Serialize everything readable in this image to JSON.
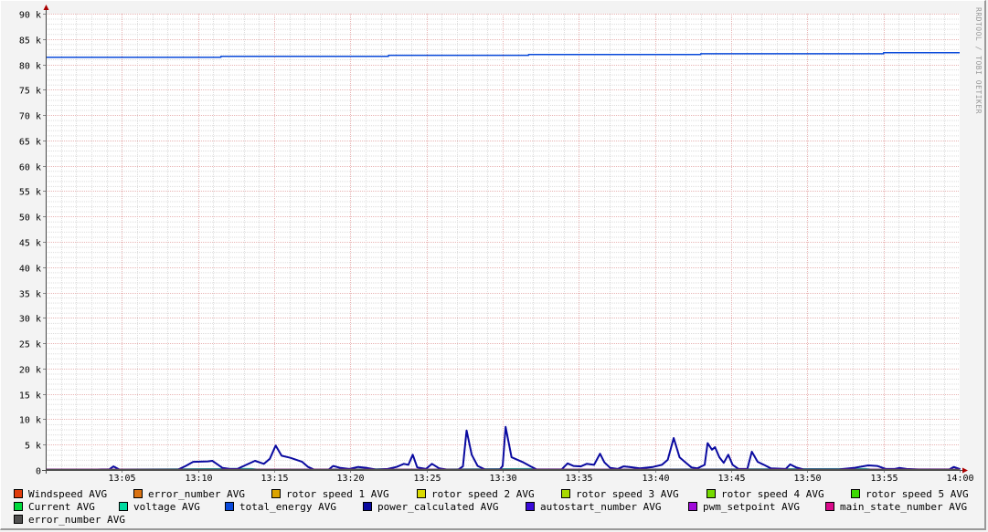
{
  "watermark": "RRDTOOL / TOBI OETIKER",
  "chart_data": {
    "type": "line",
    "title": "",
    "xlabel": "",
    "ylabel": "",
    "xlim_minutes": [
      0,
      60
    ],
    "ylim": [
      0,
      90000
    ],
    "grid": true,
    "legend_position": "bottom",
    "yticks": [
      {
        "value": 0,
        "label": "0"
      },
      {
        "value": 5000,
        "label": "5 k"
      },
      {
        "value": 10000,
        "label": "10 k"
      },
      {
        "value": 15000,
        "label": "15 k"
      },
      {
        "value": 20000,
        "label": "20 k"
      },
      {
        "value": 25000,
        "label": "25 k"
      },
      {
        "value": 30000,
        "label": "30 k"
      },
      {
        "value": 35000,
        "label": "35 k"
      },
      {
        "value": 40000,
        "label": "40 k"
      },
      {
        "value": 45000,
        "label": "45 k"
      },
      {
        "value": 50000,
        "label": "50 k"
      },
      {
        "value": 55000,
        "label": "55 k"
      },
      {
        "value": 60000,
        "label": "60 k"
      },
      {
        "value": 65000,
        "label": "65 k"
      },
      {
        "value": 70000,
        "label": "70 k"
      },
      {
        "value": 75000,
        "label": "75 k"
      },
      {
        "value": 80000,
        "label": "80 k"
      },
      {
        "value": 85000,
        "label": "85 k"
      },
      {
        "value": 90000,
        "label": "90 k"
      }
    ],
    "xticks": [
      {
        "minute": 5,
        "label": "13:05"
      },
      {
        "minute": 10,
        "label": "13:10"
      },
      {
        "minute": 15,
        "label": "13:15"
      },
      {
        "minute": 20,
        "label": "13:20"
      },
      {
        "minute": 25,
        "label": "13:25"
      },
      {
        "minute": 30,
        "label": "13:30"
      },
      {
        "minute": 35,
        "label": "13:35"
      },
      {
        "minute": 40,
        "label": "13:40"
      },
      {
        "minute": 45,
        "label": "13:45"
      },
      {
        "minute": 50,
        "label": "13:50"
      },
      {
        "minute": 55,
        "label": "13:55"
      },
      {
        "minute": 60,
        "label": "14:00"
      }
    ],
    "series": [
      {
        "name": "Windspeed AVG",
        "color": "#E03C0B",
        "points": [
          [
            0,
            0
          ],
          [
            60,
            0
          ]
        ]
      },
      {
        "name": "error_number AVG",
        "color": "#DA7211",
        "points": [
          [
            0,
            0
          ],
          [
            60,
            0
          ]
        ]
      },
      {
        "name": "rotor speed 1 AVG",
        "color": "#DAA300",
        "points": [
          [
            0,
            0
          ],
          [
            60,
            0
          ]
        ]
      },
      {
        "name": "rotor speed 2 AVG",
        "color": "#DADA00",
        "points": [
          [
            0,
            0
          ],
          [
            60,
            0
          ]
        ]
      },
      {
        "name": "rotor speed 3 AVG",
        "color": "#A8DA00",
        "points": [
          [
            0,
            0
          ],
          [
            60,
            0
          ]
        ]
      },
      {
        "name": "rotor speed 4 AVG",
        "color": "#75DA00",
        "points": [
          [
            0,
            0
          ],
          [
            60,
            0
          ]
        ]
      },
      {
        "name": "rotor speed 5 AVG",
        "color": "#3CDA00",
        "points": [
          [
            0,
            0
          ],
          [
            60,
            0
          ]
        ]
      },
      {
        "name": "Current AVG",
        "color": "#00DA3C",
        "points": [
          [
            0,
            0
          ],
          [
            60,
            0
          ]
        ]
      },
      {
        "name": "voltage AVG",
        "color": "#00DAA0",
        "points": [
          [
            0,
            80
          ],
          [
            13.5,
            250
          ],
          [
            14,
            80
          ],
          [
            22.3,
            200
          ],
          [
            23,
            80
          ],
          [
            31.8,
            250
          ],
          [
            32.3,
            80
          ],
          [
            53.8,
            250
          ],
          [
            54.3,
            80
          ],
          [
            60,
            80
          ]
        ]
      },
      {
        "name": "total_energy AVG",
        "color": "#0A4ADA",
        "points": [
          [
            0,
            81400
          ],
          [
            11.5,
            81400
          ],
          [
            11.5,
            81600
          ],
          [
            22.5,
            81600
          ],
          [
            22.5,
            81800
          ],
          [
            31.7,
            81800
          ],
          [
            31.7,
            81950
          ],
          [
            43,
            81950
          ],
          [
            43,
            82100
          ],
          [
            55,
            82100
          ],
          [
            55,
            82300
          ],
          [
            60,
            82300
          ]
        ]
      },
      {
        "name": "power_calculated AVG",
        "color": "#0A0AA0",
        "points": [
          [
            0,
            0
          ],
          [
            3.5,
            0
          ],
          [
            3.8,
            100
          ],
          [
            4.3,
            100
          ],
          [
            4.6,
            700
          ],
          [
            5,
            0
          ],
          [
            8,
            0
          ],
          [
            9,
            100
          ],
          [
            9.5,
            800
          ],
          [
            10,
            1600
          ],
          [
            11,
            1700
          ],
          [
            11.3,
            1800
          ],
          [
            11.6,
            1200
          ],
          [
            12,
            400
          ],
          [
            12.5,
            200
          ],
          [
            13,
            200
          ],
          [
            13.6,
            1000
          ],
          [
            14.2,
            1800
          ],
          [
            14.8,
            1200
          ],
          [
            15.2,
            2200
          ],
          [
            15.6,
            4800
          ],
          [
            16,
            2800
          ],
          [
            16.6,
            2400
          ],
          [
            17.4,
            1600
          ],
          [
            17.8,
            600
          ],
          [
            18.2,
            0
          ],
          [
            19.2,
            0
          ],
          [
            19.5,
            800
          ],
          [
            20,
            400
          ],
          [
            20.6,
            200
          ],
          [
            21.2,
            600
          ],
          [
            21.8,
            400
          ],
          [
            22.4,
            0
          ],
          [
            23.2,
            200
          ],
          [
            23.8,
            600
          ],
          [
            24.3,
            1200
          ],
          [
            24.6,
            1000
          ],
          [
            24.9,
            3000
          ],
          [
            25.2,
            500
          ],
          [
            25.8,
            200
          ],
          [
            26.2,
            1200
          ],
          [
            26.7,
            300
          ],
          [
            27.2,
            0
          ],
          [
            28,
            0
          ],
          [
            28.3,
            700
          ],
          [
            28.55,
            7800
          ],
          [
            28.9,
            3000
          ],
          [
            29.3,
            800
          ],
          [
            29.8,
            100
          ],
          [
            30.8,
            100
          ],
          [
            31,
            800
          ],
          [
            31.2,
            8500
          ],
          [
            31.6,
            2500
          ],
          [
            32.4,
            1500
          ],
          [
            32.9,
            700
          ],
          [
            33.3,
            100
          ],
          [
            35,
            100
          ],
          [
            35.4,
            1300
          ],
          [
            35.8,
            800
          ],
          [
            36.3,
            700
          ],
          [
            36.7,
            1200
          ],
          [
            37.2,
            1000
          ],
          [
            37.6,
            3200
          ],
          [
            37.9,
            1500
          ],
          [
            38.3,
            400
          ],
          [
            38.8,
            200
          ],
          [
            39.2,
            700
          ],
          [
            39.6,
            600
          ],
          [
            40.3,
            300
          ],
          [
            41.2,
            600
          ],
          [
            41.8,
            1000
          ],
          [
            42.2,
            2000
          ],
          [
            42.6,
            6300
          ],
          [
            43,
            2500
          ],
          [
            43.4,
            1500
          ],
          [
            43.8,
            500
          ],
          [
            44.2,
            300
          ],
          [
            44.7,
            1000
          ],
          [
            44.9,
            5300
          ],
          [
            45.2,
            4000
          ],
          [
            45.4,
            4500
          ],
          [
            45.7,
            2500
          ],
          [
            46,
            1400
          ],
          [
            46.3,
            3000
          ],
          [
            46.6,
            1000
          ],
          [
            47,
            200
          ],
          [
            47.6,
            200
          ],
          [
            47.9,
            3600
          ],
          [
            48.3,
            1600
          ],
          [
            48.8,
            900
          ],
          [
            49.2,
            300
          ],
          [
            50.2,
            200
          ],
          [
            50.5,
            1100
          ],
          [
            50.9,
            500
          ],
          [
            51.4,
            100
          ],
          [
            53.8,
            100
          ],
          [
            54.8,
            400
          ],
          [
            55.8,
            900
          ],
          [
            56.4,
            800
          ],
          [
            57,
            200
          ],
          [
            57.6,
            200
          ],
          [
            57.9,
            400
          ],
          [
            58.4,
            200
          ],
          [
            59.2,
            100
          ],
          [
            61.3,
            100
          ],
          [
            61.6,
            600
          ],
          [
            62,
            200
          ],
          [
            62,
            0
          ]
        ]
      },
      {
        "name": "autostart_number AVG",
        "color": "#3A0ADA",
        "points": [
          [
            0,
            0
          ],
          [
            60,
            0
          ]
        ]
      },
      {
        "name": "pwm_setpoint AVG",
        "color": "#A00ADA",
        "points": [
          [
            0,
            0
          ],
          [
            60,
            0
          ]
        ]
      },
      {
        "name": "main_state_number AVG",
        "color": "#DA0A8A",
        "points": [
          [
            0,
            0
          ],
          [
            60,
            0
          ]
        ]
      },
      {
        "name": "error_number AVG",
        "color": "#505050",
        "points": [
          [
            0,
            0
          ],
          [
            60,
            0
          ]
        ]
      }
    ]
  }
}
